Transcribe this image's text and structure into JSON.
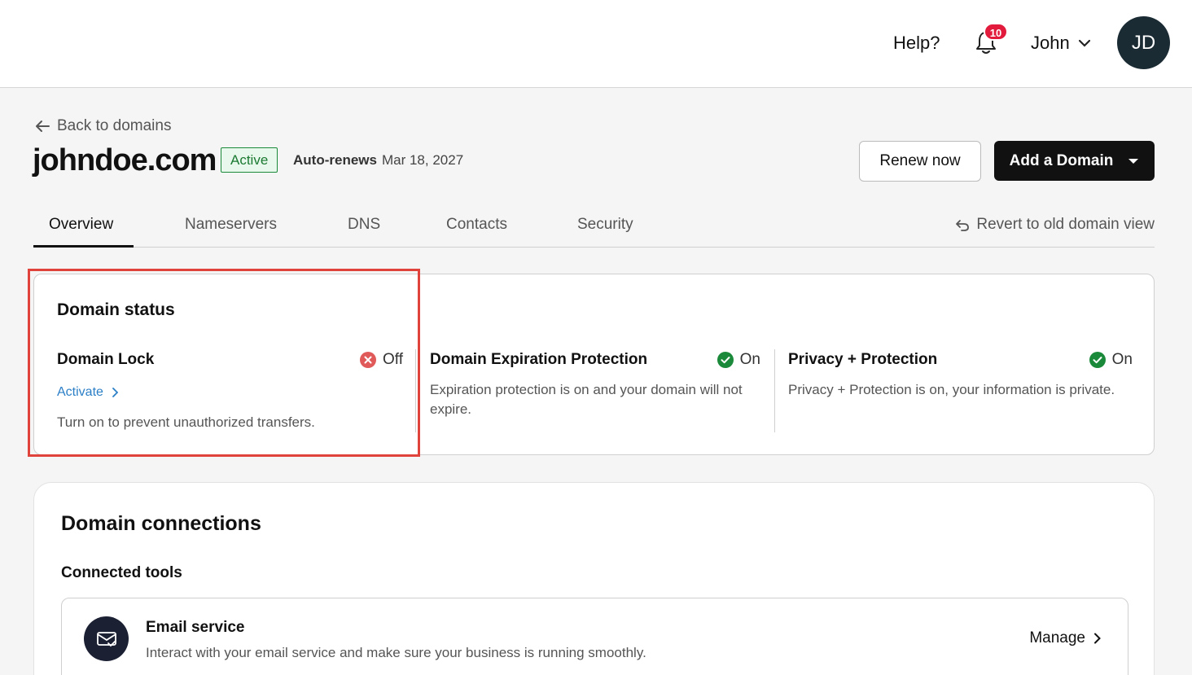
{
  "header": {
    "help": "Help?",
    "notifications_count": "10",
    "user_name": "John",
    "avatar_initials": "JD"
  },
  "page": {
    "back_link": "Back to domains",
    "domain": "johndoe.com",
    "status": "Active",
    "autorenew_label": "Auto-renews",
    "autorenew_date": "Mar 18, 2027",
    "renew_button": "Renew now",
    "add_domain_button": "Add a Domain"
  },
  "tabs": {
    "items": [
      "Overview",
      "Nameservers",
      "DNS",
      "Contacts",
      "Security"
    ],
    "active": "Overview",
    "revert": "Revert to old domain view"
  },
  "domain_status": {
    "title": "Domain status",
    "lock": {
      "title": "Domain Lock",
      "state": "Off",
      "action": "Activate",
      "description": "Turn on to prevent unauthorized transfers."
    },
    "expiration": {
      "title": "Domain Expiration Protection",
      "state": "On",
      "description_line1": "Expiration protection is on and your domain will not",
      "description_line2": "expire."
    },
    "privacy": {
      "title": "Privacy + Protection",
      "state": "On",
      "description": "Privacy + Protection is on, your information is private."
    }
  },
  "connections": {
    "title": "Domain connections",
    "subtitle": "Connected tools",
    "tool": {
      "name": "Email service",
      "description": "Interact with your email service and make sure your business is running smoothly.",
      "action": "Manage"
    }
  },
  "colors": {
    "accent_link": "#2b7fc7",
    "success": "#1a8a3a",
    "error": "#e05a5a",
    "highlight": "#e0423c",
    "dark": "#111111"
  }
}
